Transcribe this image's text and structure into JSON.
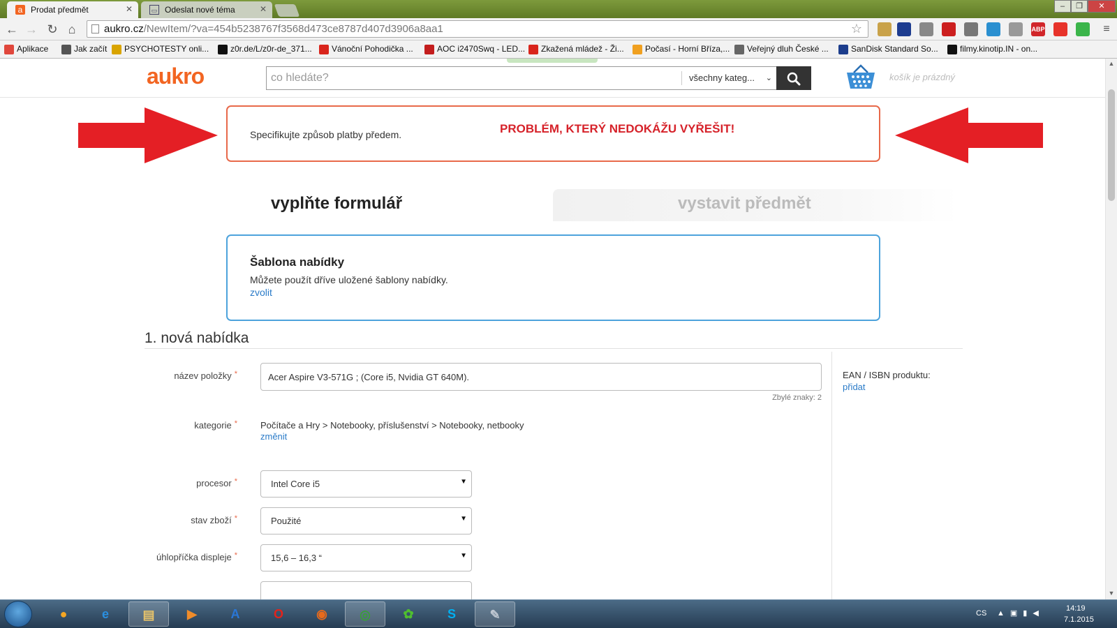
{
  "browser": {
    "tabs": [
      {
        "label": "Prodat předmět",
        "icon": "aukro-favicon"
      },
      {
        "label": "Odeslat nové téma",
        "icon": "forum-favicon"
      }
    ],
    "url_host": "aukro.cz",
    "url_path": "/NewItem/?va=454b5238767f3568d473ce8787d407d3906a8aa1",
    "bookmarks": [
      {
        "label": "Aplikace",
        "icon": "apps-grid-icon",
        "color": "#e0473c"
      },
      {
        "label": "Jak začít",
        "icon": "page-icon",
        "color": "#555"
      },
      {
        "label": "PSYCHOTESTY onli...",
        "icon": "crown-icon",
        "color": "#d9a400"
      },
      {
        "label": "z0r.de/L/z0r-de_371...",
        "icon": "z0r-icon",
        "color": "#111"
      },
      {
        "label": "Vánoční Pohodička ...",
        "icon": "youtube-icon",
        "color": "#d9251c"
      },
      {
        "label": "AOC i2470Swq - LED...",
        "icon": "shop-icon",
        "color": "#c31d1d"
      },
      {
        "label": "Zkažená mládež - Ži...",
        "icon": "youtube-icon",
        "color": "#d9251c"
      },
      {
        "label": "Počasí - Horní Bříza,...",
        "icon": "sun-icon",
        "color": "#f0a020"
      },
      {
        "label": "Veřejný dluh České ...",
        "icon": "globe-icon",
        "color": "#666"
      },
      {
        "label": "SanDisk Standard So...",
        "icon": "sandisk-icon",
        "color": "#1c3d8c"
      },
      {
        "label": "filmy.kinotip.IN - on...",
        "icon": "k-icon",
        "color": "#111"
      }
    ],
    "extensions": [
      {
        "icon": "extension-bird-icon",
        "color": "#c9a24a"
      },
      {
        "icon": "uk-flag-icon",
        "color": "#1d3c8f"
      },
      {
        "icon": "calendar-ext-icon",
        "color": "#888"
      },
      {
        "icon": "lastpass-icon",
        "color": "#cc1f1f"
      },
      {
        "icon": "grid-ext-icon",
        "color": "#777"
      },
      {
        "icon": "screen-ext-icon",
        "color": "#2a8fd0"
      },
      {
        "icon": "table-ext-icon",
        "color": "#999"
      },
      {
        "icon": "adblock-plus-icon",
        "color": "#d1262a",
        "text": "ABP"
      },
      {
        "icon": "avast-icon",
        "color": "#e7332a"
      },
      {
        "icon": "chat-ext-icon",
        "color": "#3bb54a"
      }
    ]
  },
  "site": {
    "logo": "aukro",
    "search_placeholder": "co hledáte?",
    "category_select": "všechny kateg...",
    "cart_text": "košík je prázdný"
  },
  "alert": {
    "message": "Specifikujte způsob platby předem.",
    "annotation": "PROBLÉM, KTERÝ NEDOKÁŽU VYŘEŠIT!",
    "annotation_color": "#d6222a"
  },
  "steps": {
    "active": "vyplňte formulář",
    "inactive": "vystavit předmět"
  },
  "template": {
    "title": "Šablona nabídky",
    "description": "Můžete použít dříve uložené šablony nabídky.",
    "link": "zvolit"
  },
  "form": {
    "section_title": "1. nová nabídka",
    "fields": {
      "title": {
        "label": "název položky",
        "value": "Acer Aspire V3-571G ; (Core i5, Nvidia GT 640M).",
        "chars_left": "Zbylé znaky: 2"
      },
      "category": {
        "label": "kategorie",
        "path": "Počítače a Hry > Notebooky, příslušenství > Notebooky, netbooky",
        "change": "změnit"
      },
      "processor": {
        "label": "procesor",
        "value": "Intel Core i5"
      },
      "condition": {
        "label": "stav zboží",
        "value": "Použité"
      },
      "display": {
        "label": "úhlopříčka displeje",
        "value": "15,6 – 16,3 “"
      }
    },
    "ean": {
      "label": "EAN / ISBN produktu:",
      "link": "přidat"
    }
  },
  "taskbar": {
    "apps": [
      {
        "name": "taskbar-app-messenger",
        "glyph": "●",
        "color": "#f5a623"
      },
      {
        "name": "taskbar-app-internet-explorer",
        "glyph": "e",
        "color": "#2a8fe0"
      },
      {
        "name": "taskbar-app-explorer",
        "glyph": "▤",
        "color": "#e9c46a"
      },
      {
        "name": "taskbar-app-media-player",
        "glyph": "▶",
        "color": "#f08c2a"
      },
      {
        "name": "taskbar-app-appstore",
        "glyph": "A",
        "color": "#2a76d6"
      },
      {
        "name": "taskbar-app-opera",
        "glyph": "O",
        "color": "#e4231b"
      },
      {
        "name": "taskbar-app-firefox",
        "glyph": "◉",
        "color": "#e86a1b"
      },
      {
        "name": "taskbar-app-chrome",
        "glyph": "◎",
        "color": "#3a9e3a"
      },
      {
        "name": "taskbar-app-icq",
        "glyph": "✿",
        "color": "#4fbf2f"
      },
      {
        "name": "taskbar-app-skype",
        "glyph": "S",
        "color": "#00aff0"
      },
      {
        "name": "taskbar-app-paint",
        "glyph": "✎",
        "color": "#bfc7d1"
      }
    ],
    "language": "CS",
    "time": "14:19",
    "date": "7.1.2015"
  }
}
